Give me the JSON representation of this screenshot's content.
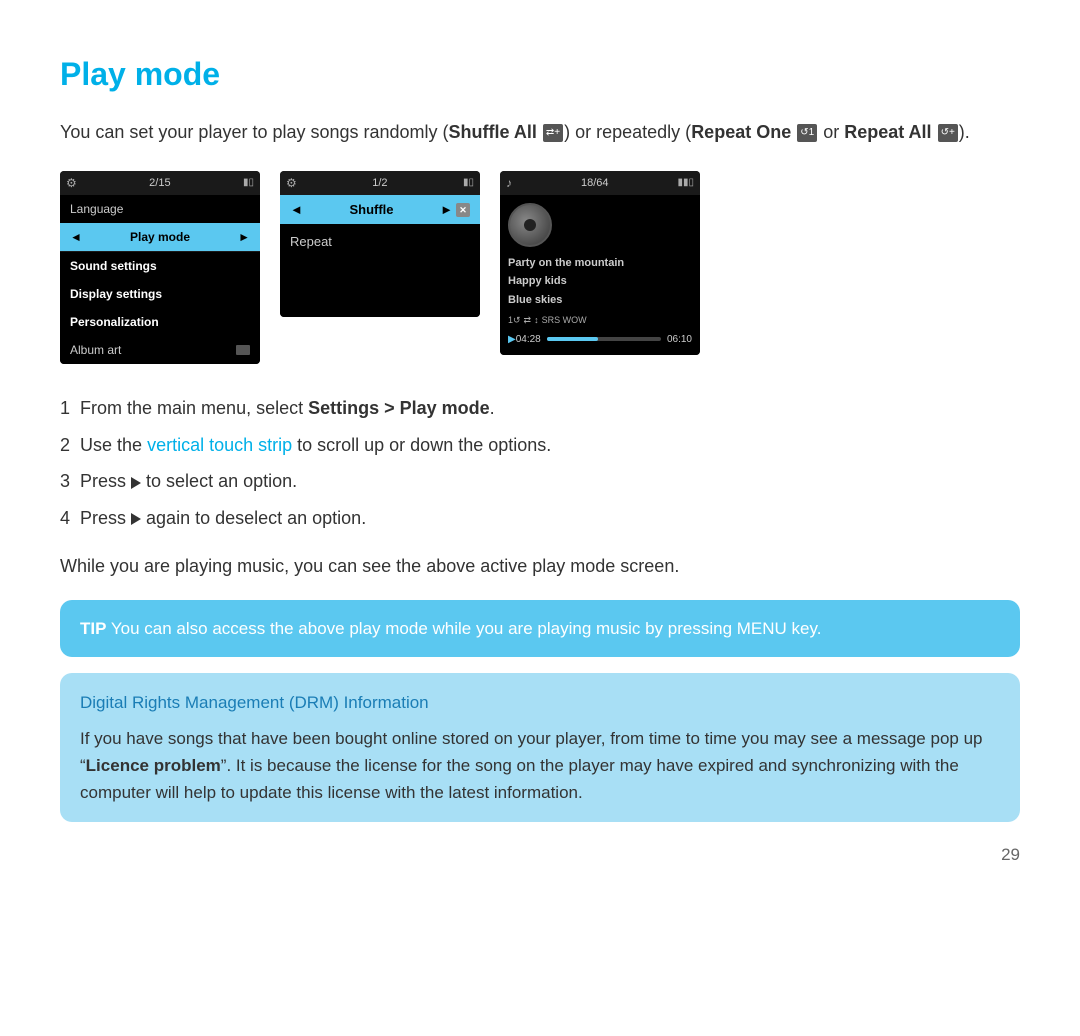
{
  "page": {
    "title": "Play mode",
    "page_number": "29"
  },
  "intro": {
    "text_before": "You can set your player to play songs randomly (",
    "shuffle_label": "Shuffle All",
    "text_middle1": ") or repeatedly (",
    "repeat_label": "Repeat",
    "text_middle2": "One",
    "text_middle3": " or ",
    "repeat_all_label": "Repeat All",
    "text_end": ")."
  },
  "screen1": {
    "gear": "⚙",
    "counter": "2/15",
    "battery": "▮",
    "items": [
      {
        "label": "Language",
        "type": "normal"
      },
      {
        "label": "Play mode",
        "type": "selected"
      },
      {
        "label": "Sound settings",
        "type": "bold"
      },
      {
        "label": "Display settings",
        "type": "bold"
      },
      {
        "label": "Personalization",
        "type": "bold"
      },
      {
        "label": "Album art",
        "type": "toggle"
      }
    ]
  },
  "screen2": {
    "gear": "⚙",
    "counter": "1/2",
    "battery": "▮",
    "items": [
      {
        "label": "Shuffle",
        "type": "selected"
      },
      {
        "label": "Repeat",
        "type": "normal"
      }
    ]
  },
  "screen3": {
    "note": "♪",
    "counter": "18/64",
    "tracks": [
      "Party on the mountain",
      "Happy kids",
      "Blue skies"
    ],
    "status": "1● ⇄ ↕ SRS WOW",
    "time_current": "04:28",
    "time_total": "06:10",
    "progress_percent": 45
  },
  "steps": [
    {
      "num": "1",
      "text_before": "From the main menu, select ",
      "bold": "Settings > Play mode",
      "text_after": "."
    },
    {
      "num": "2",
      "text_before": "Use the ",
      "highlight": "vertical touch strip",
      "text_after": " to scroll up or down the options."
    },
    {
      "num": "3",
      "text_before": "Press ▶ to select an option.",
      "bold": "",
      "text_after": ""
    },
    {
      "num": "4",
      "text_before": "Press ▶ again to deselect an option.",
      "bold": "",
      "text_after": ""
    }
  ],
  "while_text": "While you are playing music, you can see the above active play mode screen.",
  "tip": {
    "prefix": "TIP",
    "text": " You can also access the above play mode while you are playing music by pressing MENU key."
  },
  "drm": {
    "title": "Digital Rights Management (DRM) Information",
    "text_before": "If you have songs that have been bought online stored on your player, from time to time you may see a message pop up “",
    "bold": "Licence problem",
    "text_after": "”. It is because the license for the song on the player may have expired and synchronizing with the computer will help to update this license with the latest information."
  }
}
